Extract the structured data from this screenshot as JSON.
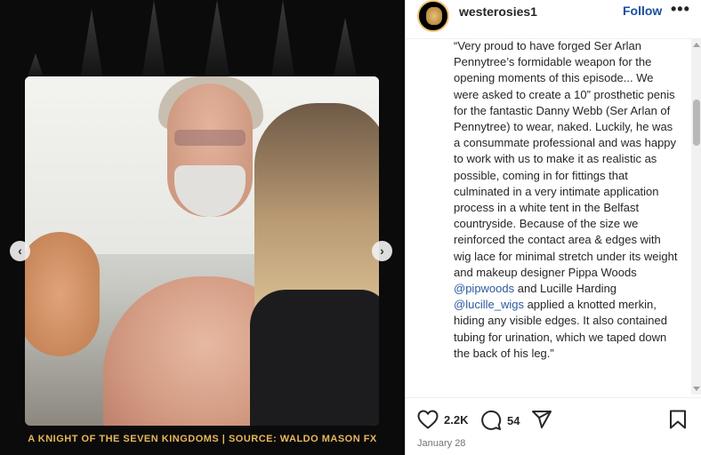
{
  "media": {
    "caption": "A KNIGHT OF THE SEVEN KINGDOMS | SOURCE: WALDO MASON FX",
    "prev_icon": "‹",
    "next_icon": "›"
  },
  "post": {
    "username": "westerosies1",
    "follow_label": "Follow",
    "more_icon": "•••",
    "caption_parts": [
      "“Very proud to have forged Ser Arlan Pennytree’s formidable weapon for the opening moments of this episode... We were asked to create a 10” prosthetic penis for the fantastic Danny Webb (Ser Arlan of Pennytree) to wear, naked. Luckily, he was a consummate professional and was happy to work with us to make it as realistic as possible, coming in for fittings that culminated in a very intimate application process in a white tent in the Belfast countryside. Because of the size we reinforced the contact area & edges with wig lace for minimal stretch under its weight and makeup designer Pippa Woods ",
      "@pipwoods",
      " and Lucille Harding ",
      "@lucille_wigs",
      " applied a knotted merkin, hiding any visible edges. It also contained tubing for urination, which we taped down the back of his leg.”"
    ],
    "likes": "2.2K",
    "comments": "54",
    "date": "January 28"
  },
  "colors": {
    "caption_gold": "#e8b75c",
    "follow_blue": "#1a4fa0",
    "mention_blue": "#2b5a9e"
  }
}
